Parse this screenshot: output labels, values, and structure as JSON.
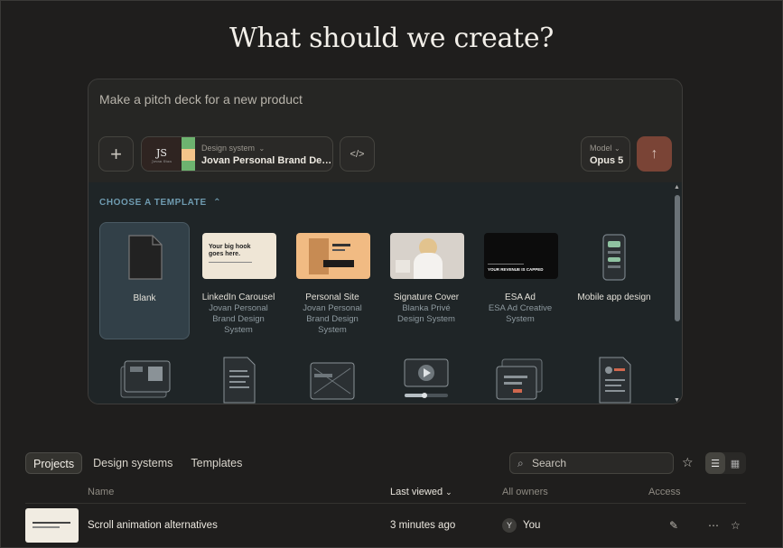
{
  "title": "What should we create?",
  "composer": {
    "prompt_placeholder": "Make a pitch deck for a new product",
    "design_system": {
      "label": "Design system",
      "name": "Jovan Personal Brand De…",
      "thumb_initials": "JS",
      "thumb_caption": "Jovan Stan",
      "swatches": [
        "#e8a15a",
        "#f3c48a",
        "#6db36f"
      ]
    },
    "model": {
      "label": "Model",
      "value": "Opus 5"
    },
    "icons": {
      "add": "plus-icon",
      "code": "code-icon",
      "send": "arrow-up-icon"
    }
  },
  "templates": {
    "heading": "CHOOSE A TEMPLATE",
    "items": [
      {
        "name": "Blank",
        "sub": ""
      },
      {
        "name": "LinkedIn Carousel",
        "sub": "Jovan Personal Brand Design System",
        "thumb_text": "Your big hook goes here."
      },
      {
        "name": "Personal Site",
        "sub": "Jovan Personal Brand Design System"
      },
      {
        "name": "Signature Cover",
        "sub": "Blanka Privé Design System"
      },
      {
        "name": "ESA Ad",
        "sub": "ESA Ad Creative System",
        "thumb_text": "YOUR REVENUE IS CAPPED"
      },
      {
        "name": "Mobile app design",
        "sub": ""
      }
    ]
  },
  "tabs": [
    "Projects",
    "Design systems",
    "Templates"
  ],
  "search_placeholder": "Search",
  "table": {
    "headers": {
      "name": "Name",
      "last_viewed": "Last viewed",
      "owners": "All owners",
      "access": "Access"
    },
    "rows": [
      {
        "name": "Scroll animation alternatives",
        "last_viewed": "3 minutes ago",
        "owner_initial": "Y",
        "owner": "You"
      }
    ]
  },
  "colors": {
    "accent_send": "#7a4436",
    "template_heading": "#6f9bb0",
    "background": "#1f1e1d"
  }
}
